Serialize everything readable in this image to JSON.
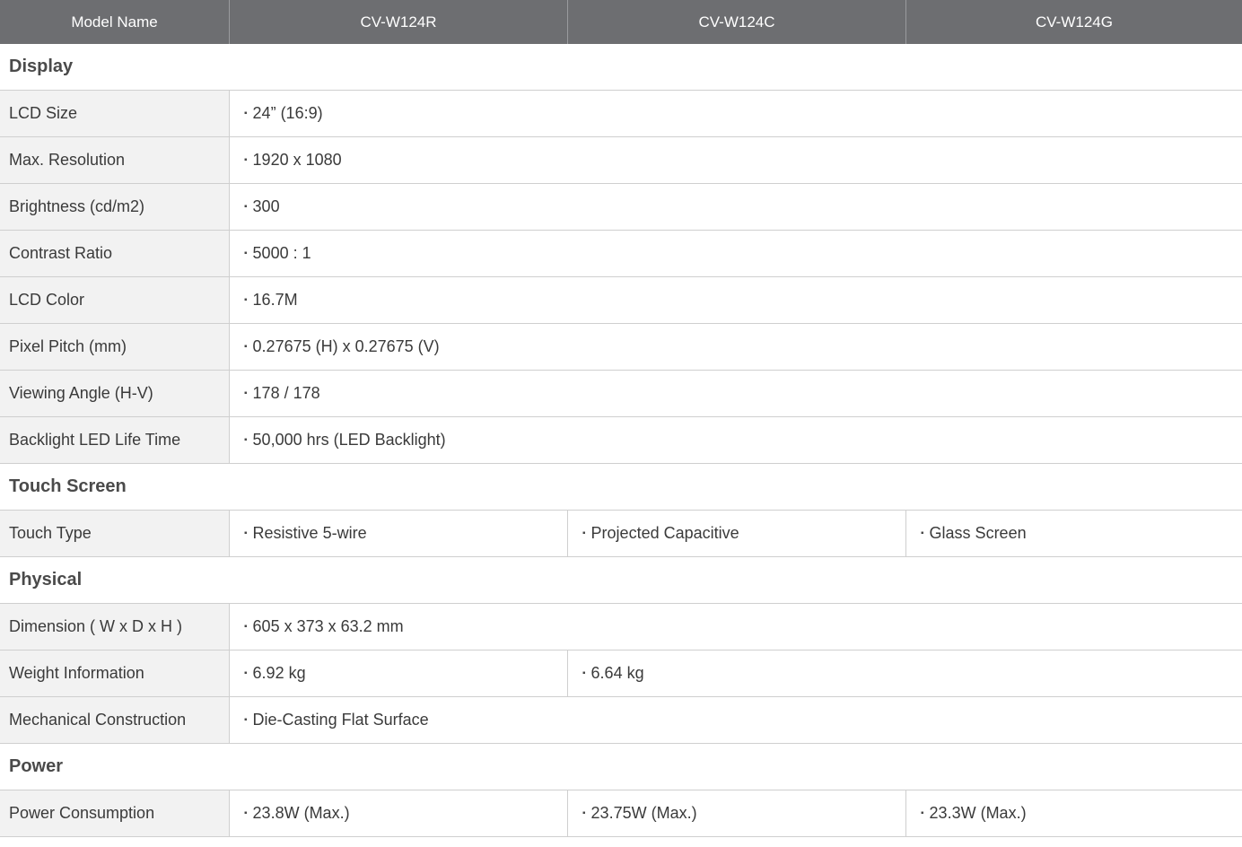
{
  "header": {
    "label": "Model Name",
    "models": [
      "CV-W124R",
      "CV-W124C",
      "CV-W124G"
    ]
  },
  "bullet": "▪",
  "sections": {
    "display": {
      "title": "Display",
      "rows": {
        "lcd_size": {
          "label": "LCD Size",
          "value": "24” (16:9)"
        },
        "max_resolution": {
          "label": "Max. Resolution",
          "value": "1920 x 1080"
        },
        "brightness": {
          "label": "Brightness (cd/m2)",
          "value": "300"
        },
        "contrast": {
          "label": "Contrast Ratio",
          "value": "5000 : 1"
        },
        "lcd_color": {
          "label": "LCD Color",
          "value": "16.7M"
        },
        "pixel_pitch": {
          "label": "Pixel Pitch (mm)",
          "value": "0.27675 (H) x 0.27675 (V)"
        },
        "viewing_angle": {
          "label": "Viewing Angle (H-V)",
          "value": "178 / 178"
        },
        "backlight": {
          "label": "Backlight LED Life Time",
          "value": "50,000 hrs (LED Backlight)"
        }
      }
    },
    "touch": {
      "title": "Touch Screen",
      "rows": {
        "touch_type": {
          "label": "Touch Type",
          "values": [
            "Resistive 5-wire",
            "Projected Capacitive",
            "Glass Screen"
          ]
        }
      }
    },
    "physical": {
      "title": "Physical",
      "rows": {
        "dimension": {
          "label": "Dimension ( W x D x H )",
          "value": "605 x 373 x 63.2 mm"
        },
        "weight": {
          "label": "Weight Information",
          "values": [
            "6.92 kg",
            "6.64 kg"
          ]
        },
        "mechanical": {
          "label": "Mechanical Construction",
          "value": "Die-Casting Flat Surface"
        }
      }
    },
    "power": {
      "title": "Power",
      "rows": {
        "consumption": {
          "label": "Power Consumption",
          "values": [
            "23.8W (Max.)",
            "23.75W (Max.)",
            "23.3W (Max.)"
          ]
        }
      }
    }
  },
  "colors": {
    "header_bg": "#6d6e71",
    "label_bg": "#f2f2f2",
    "border": "#cfcfcf"
  }
}
